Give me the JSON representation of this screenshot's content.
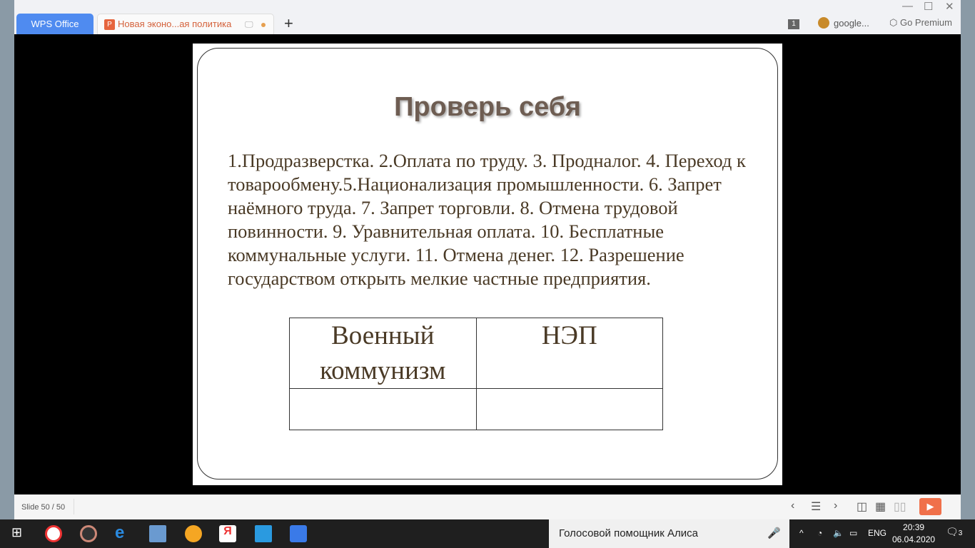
{
  "titlebar": {
    "home_tab": "WPS Office",
    "doc_tab": "Новая эконо...ая политика",
    "new_tab": "+",
    "window_count": "1",
    "account": "google...",
    "premium": "Go Premium"
  },
  "slide": {
    "title": "Проверь себя",
    "body": "1.Продразверстка. 2.Оплата по труду. 3. Продналог. 4. Переход к товарообмену.5.Национализация промышленности. 6. Запрет наёмного труда. 7. Запрет торговли. 8. Отмена трудовой повинности. 9. Уравнительная оплата. 10. Бесплатные коммунальные услуги. 11. Отмена денег. 12. Разрешение государством открыть мелкие частные предприятия.",
    "table": {
      "headers": [
        "Военный коммунизм",
        "НЭП"
      ],
      "rows": [
        [
          "",
          ""
        ]
      ]
    }
  },
  "status": {
    "slide_indicator": "Slide 50 / 50"
  },
  "taskbar": {
    "search": "Голосовой помощник Алиса",
    "lang": "ENG",
    "time": "20:39",
    "date": "06.04.2020",
    "notifications": "3"
  }
}
